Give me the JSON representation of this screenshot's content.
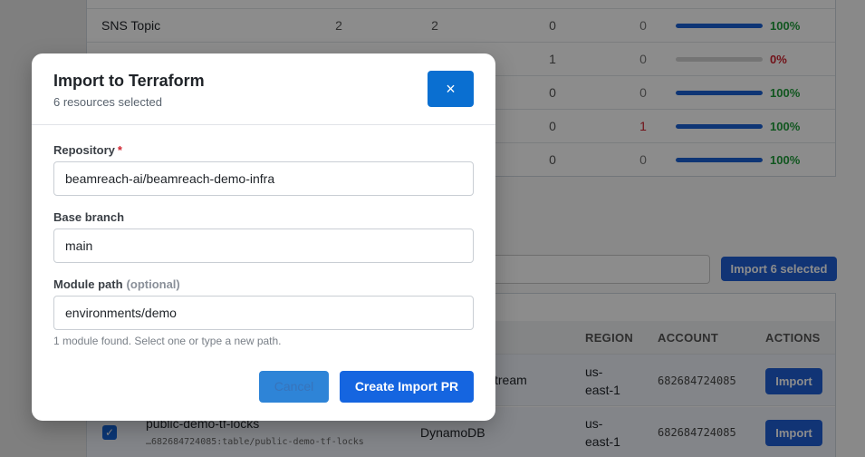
{
  "summary_rows": [
    {
      "name": "SNS Topic",
      "a": "2",
      "b": "2",
      "c": "0",
      "d": "0",
      "pct_value": 100,
      "pct": "100%"
    },
    {
      "name": "",
      "a": "",
      "b": "",
      "c": "1",
      "d": "0",
      "pct_value": 0,
      "pct": "0%"
    },
    {
      "name": "",
      "a": "",
      "b": "",
      "c": "0",
      "d": "0",
      "pct_value": 100,
      "pct": "100%"
    },
    {
      "name": "",
      "a": "",
      "b": "",
      "c": "0",
      "d": "1",
      "pct_value": 100,
      "pct": "100%"
    },
    {
      "name": "",
      "a": "",
      "b": "",
      "c": "0",
      "d": "0",
      "pct_value": 100,
      "pct": "100%"
    }
  ],
  "import_selected_label": "Import 6 selected",
  "resource_table": {
    "headers": {
      "region": "REGION",
      "account": "ACCOUNT",
      "actions": "ACTIONS"
    },
    "rows": [
      {
        "name": "",
        "arn": "",
        "type": "tream",
        "region_l1": "us-",
        "region_l2": "east-1",
        "account": "682684724085",
        "action": "Import"
      },
      {
        "name": "public-demo-tf-locks",
        "arn": "…682684724085:table/public-demo-tf-locks",
        "type": "DynamoDB",
        "region_l1": "us-",
        "region_l2": "east-1",
        "account": "682684724085",
        "action": "Import"
      }
    ]
  },
  "modal": {
    "title": "Import to Terraform",
    "subtitle": "6 resources selected",
    "close_label": "×",
    "repository": {
      "label": "Repository",
      "required_mark": "*",
      "value": "beamreach-ai/beamreach-demo-infra"
    },
    "base_branch": {
      "label": "Base branch",
      "value": "main"
    },
    "module_path": {
      "label": "Module path",
      "optional_tag": "(optional)",
      "value": "environments/demo"
    },
    "help": "1 module found. Select one or type a new path.",
    "cancel_label": "Cancel",
    "submit_label": "Create Import PR"
  }
}
